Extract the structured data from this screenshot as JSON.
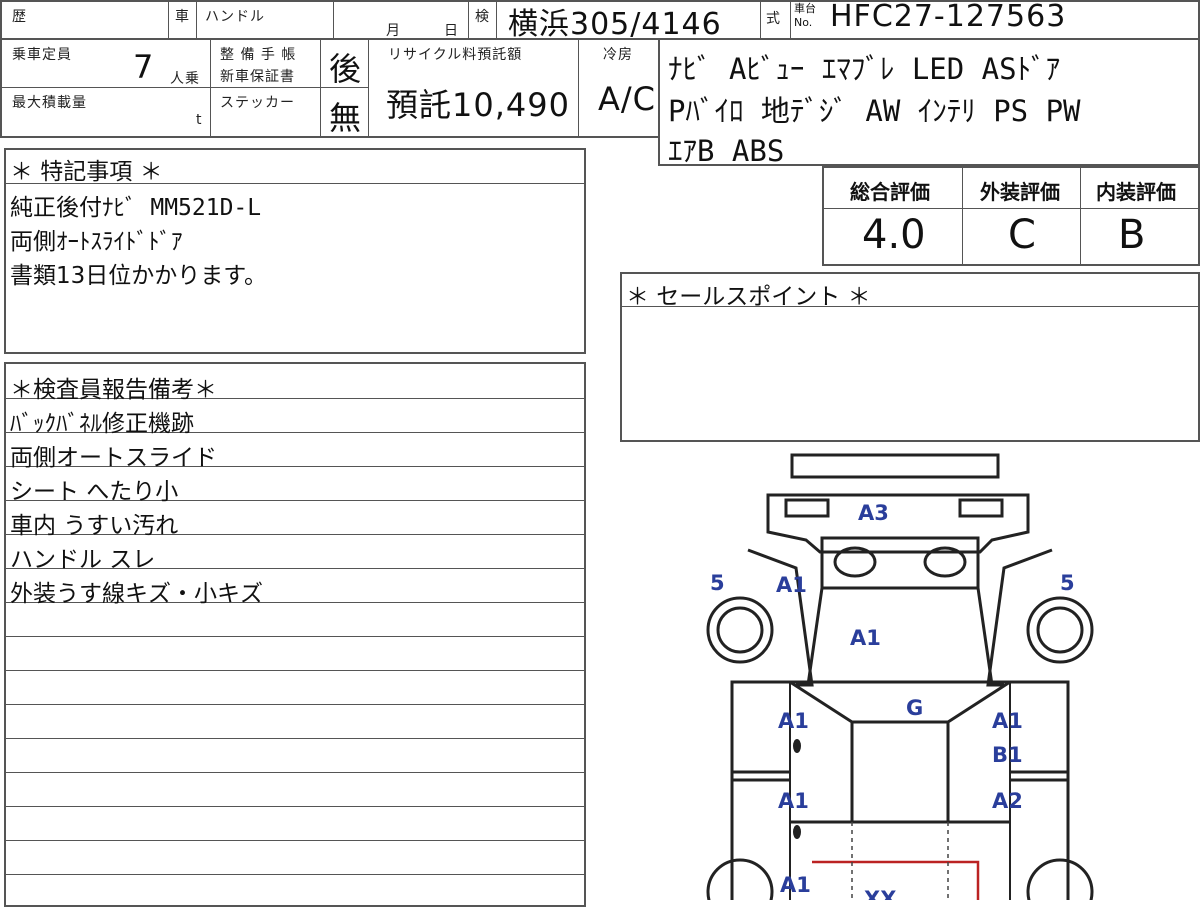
{
  "header": {
    "history_label": "歴",
    "vehicle_label": "車",
    "handle_label": "ハンドル",
    "month_label": "月",
    "day_label": "日",
    "inspection_label": "検",
    "inspection_value": "横浜305/4146",
    "model_label": "式",
    "chassis_label_top": "車台",
    "chassis_label_bottom": "No.",
    "chassis_value": "HFC27-127563"
  },
  "capacity": {
    "label": "乗車定員",
    "value": "7",
    "unit": "人乗"
  },
  "load": {
    "label": "最大積載量",
    "unit": "t"
  },
  "maintenance": {
    "label_line1": "整 備 手 帳",
    "label_line2": "新車保証書",
    "value": "後"
  },
  "sticker": {
    "label": "ステッカー",
    "value": "無"
  },
  "recycle": {
    "label": "リサイクル料預託額",
    "value": "預託10,490"
  },
  "cooling": {
    "label": "冷房",
    "value": "A/C"
  },
  "equipment": {
    "lines": [
      "ﾅﾋﾞ Aﾋﾞｭｰ ｴﾏﾌﾞﾚ LED ASﾄﾞｱ",
      "Pﾊﾞｲﾛ 地ﾃﾞｼﾞ AW ｲﾝﾃﾘ PS PW",
      "ｴｱB ABS"
    ]
  },
  "ratings": {
    "overall": {
      "label": "総合評価",
      "value": "4.0"
    },
    "exterior": {
      "label": "外装評価",
      "value": "C"
    },
    "interior": {
      "label": "内装評価",
      "value": "B"
    }
  },
  "special_notes": {
    "title": "＊ 特記事項 ＊",
    "lines": [
      "純正後付ﾅﾋﾞ MM521D-L",
      "両側ｵｰﾄｽﾗｲﾄﾞﾄﾞｱ",
      "書類13日位かかります。"
    ]
  },
  "sales_points": {
    "title": "＊ セールスポイント ＊"
  },
  "inspector_report": {
    "title": "＊検査員報告備考＊",
    "lines": [
      "ﾊﾞｯｸﾊﾞﾈﾙ修正機跡",
      "両側オートスライド",
      "シート へたり小",
      "車内 うすい汚れ",
      "ハンドル スレ",
      "外装うす線キズ・小キズ"
    ]
  },
  "damage_map": {
    "marks": {
      "front_bumper": "A3",
      "left_front_fender": "A1",
      "right_front_tire": "5",
      "left_front_tire": "5",
      "hood": "A1",
      "roof_front": "G",
      "left_front_door": "A1",
      "right_front_door_a": "A1",
      "right_front_door_b": "B1",
      "left_rear_door": "A1",
      "right_rear_door": "A2",
      "left_rear_quarter": "A1",
      "rear_panel": "XX"
    }
  }
}
